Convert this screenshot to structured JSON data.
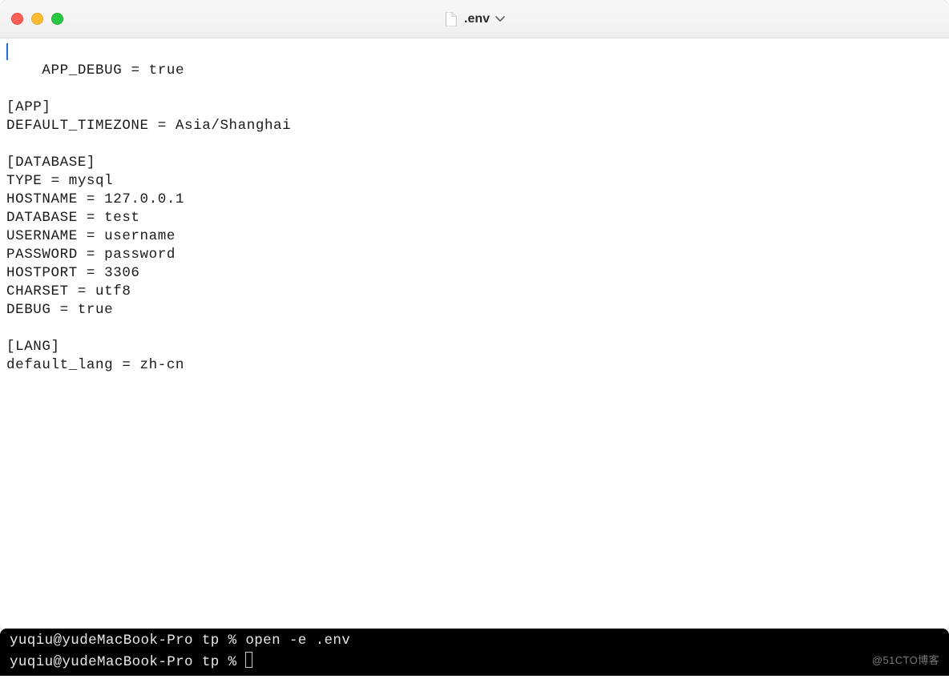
{
  "window": {
    "title": ".env"
  },
  "editor": {
    "lines": [
      "APP_DEBUG = true",
      "",
      "[APP]",
      "DEFAULT_TIMEZONE = Asia/Shanghai",
      "",
      "[DATABASE]",
      "TYPE = mysql",
      "HOSTNAME = 127.0.0.1",
      "DATABASE = test",
      "USERNAME = username",
      "PASSWORD = password",
      "HOSTPORT = 3306",
      "CHARSET = utf8",
      "DEBUG = true",
      "",
      "[LANG]",
      "default_lang = zh-cn"
    ]
  },
  "terminal": {
    "line1_prompt": "yuqiu@yudeMacBook-Pro tp % ",
    "line1_cmd": "open -e .env",
    "line2_prompt": "yuqiu@yudeMacBook-Pro tp % "
  },
  "watermark": "@51CTO博客"
}
